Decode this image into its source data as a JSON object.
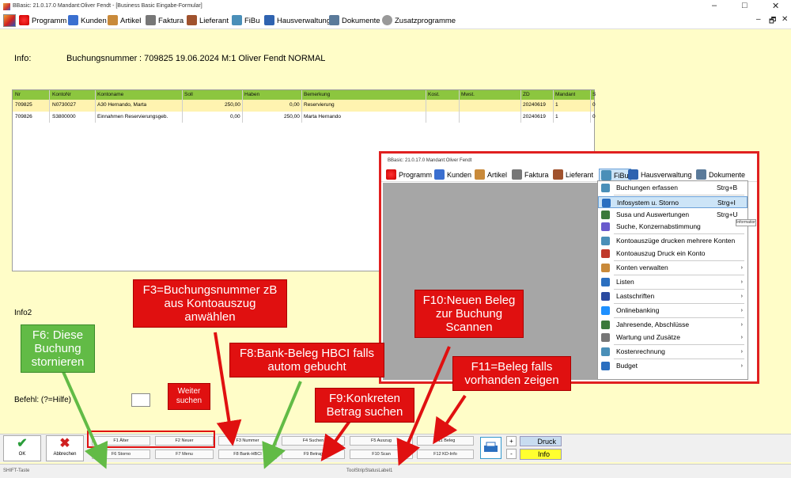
{
  "window": {
    "title": "BBasic: 21.0.17.0 Mandant:Oliver Fendt - [Business Basic Eingabe-Formular]",
    "minimize": "–",
    "maximize": "□",
    "close": "✕",
    "mdi_minimize": "–",
    "mdi_restore": "🗗",
    "mdi_close": "✕"
  },
  "menu": [
    "Programm",
    "Kunden",
    "Artikel",
    "Faktura",
    "Lieferant",
    "FiBu",
    "Hausverwaltung",
    "Dokumente",
    "Zusatzprogramme"
  ],
  "info": {
    "label": "Info:",
    "buchung_label": "Buchungsnummer",
    "buchung_value": ": 709825 19.06.2024  M:1 Oliver Fendt  NORMAL"
  },
  "grid": {
    "headers": [
      "Nr",
      "KontoNr",
      "Kontoname",
      "Soll",
      "Haben",
      "Bemerkung",
      "Kost.",
      "Mwst.",
      "ZD",
      "Mandant",
      "S"
    ],
    "rows": [
      [
        "709825",
        "N0730027",
        "A30 Hernando, Marta",
        "250,00",
        "0,00",
        "Reservierung",
        "",
        "",
        "20240619",
        "1",
        "0"
      ],
      [
        "709826",
        "S3800000",
        "Einnahmen Reservierungsgeb.",
        "0,00",
        "250,00",
        "Marta Hernando",
        "",
        "",
        "20240619",
        "1",
        "0"
      ]
    ]
  },
  "labels": {
    "info2": "Info2",
    "befehl": "Befehl: (?=Hilfe)"
  },
  "buttons": {
    "ok": "OK",
    "abbrechen": "Abbrechen",
    "druck": "Druck",
    "info": "Info",
    "plus": "+",
    "minus": "-"
  },
  "fkeys_top": [
    "F1 Älter",
    "F2 Neuer",
    "F3 Nummer",
    "F4 Suchen",
    "F5 Auszug",
    "F11 Beleg"
  ],
  "fkeys_bottom": [
    "F6 Storno",
    "F7 Menu",
    "F8 Bank-HBCI",
    "F9 Betrag",
    "F10 Scan",
    "F12 KD-Info"
  ],
  "status": {
    "left": "SHIFT-Taste",
    "center": "ToolStripStatusLabel1"
  },
  "callouts": {
    "f3": "F3=Buchungsnummer zB aus Kontoauszug anwählen",
    "f6": "F6: Diese Buchung stornieren",
    "weiter": "Weiter suchen",
    "f8": "F8:Bank-Beleg HBCI falls autom gebucht",
    "f9": "F9:Konkreten Betrag suchen",
    "f10": "F10:Neuen Beleg zur Buchung Scannen",
    "f11": "F11=Beleg falls vorhanden zeigen"
  },
  "inset": {
    "title": "BBasic: 21.0.17.0 Mandant:Oliver Fendt",
    "menu": [
      "Programm",
      "Kunden",
      "Artikel",
      "Faktura",
      "Lieferant",
      "FiBu",
      "Hausverwaltung",
      "Dokumente"
    ],
    "items": [
      {
        "label": "Buchungen erfassen",
        "shortcut": "Strg+B"
      },
      {
        "label": "Infosystem u. Storno",
        "shortcut": "Strg+I"
      },
      {
        "label": "Susa und Auswertungen",
        "shortcut": "Strg+U"
      },
      {
        "label": "Suche, Konzernabstimmung",
        "shortcut": ""
      },
      {
        "label": "Kontoauszüge drucken mehrere Konten",
        "shortcut": ""
      },
      {
        "label": "Kontoauszug Druck ein Konto",
        "shortcut": ""
      },
      {
        "label": "Konten verwalten",
        "shortcut": "›"
      },
      {
        "label": "Listen",
        "shortcut": "›"
      },
      {
        "label": "Lastschriften",
        "shortcut": "›"
      },
      {
        "label": "Onlinebanking",
        "shortcut": "›"
      },
      {
        "label": "Jahresende, Abschlüsse",
        "shortcut": "›"
      },
      {
        "label": "Wartung und Zusätze",
        "shortcut": "›"
      },
      {
        "label": "Kostenrechnung",
        "shortcut": "›"
      },
      {
        "label": "Budget",
        "shortcut": "›"
      }
    ],
    "tooltip": "Informationen"
  },
  "colors": {
    "background": "#fffdc8",
    "grid_header": "#8cc63f",
    "callout_red": "#e01010",
    "callout_green": "#62bb46",
    "info_button": "#ffff30"
  }
}
